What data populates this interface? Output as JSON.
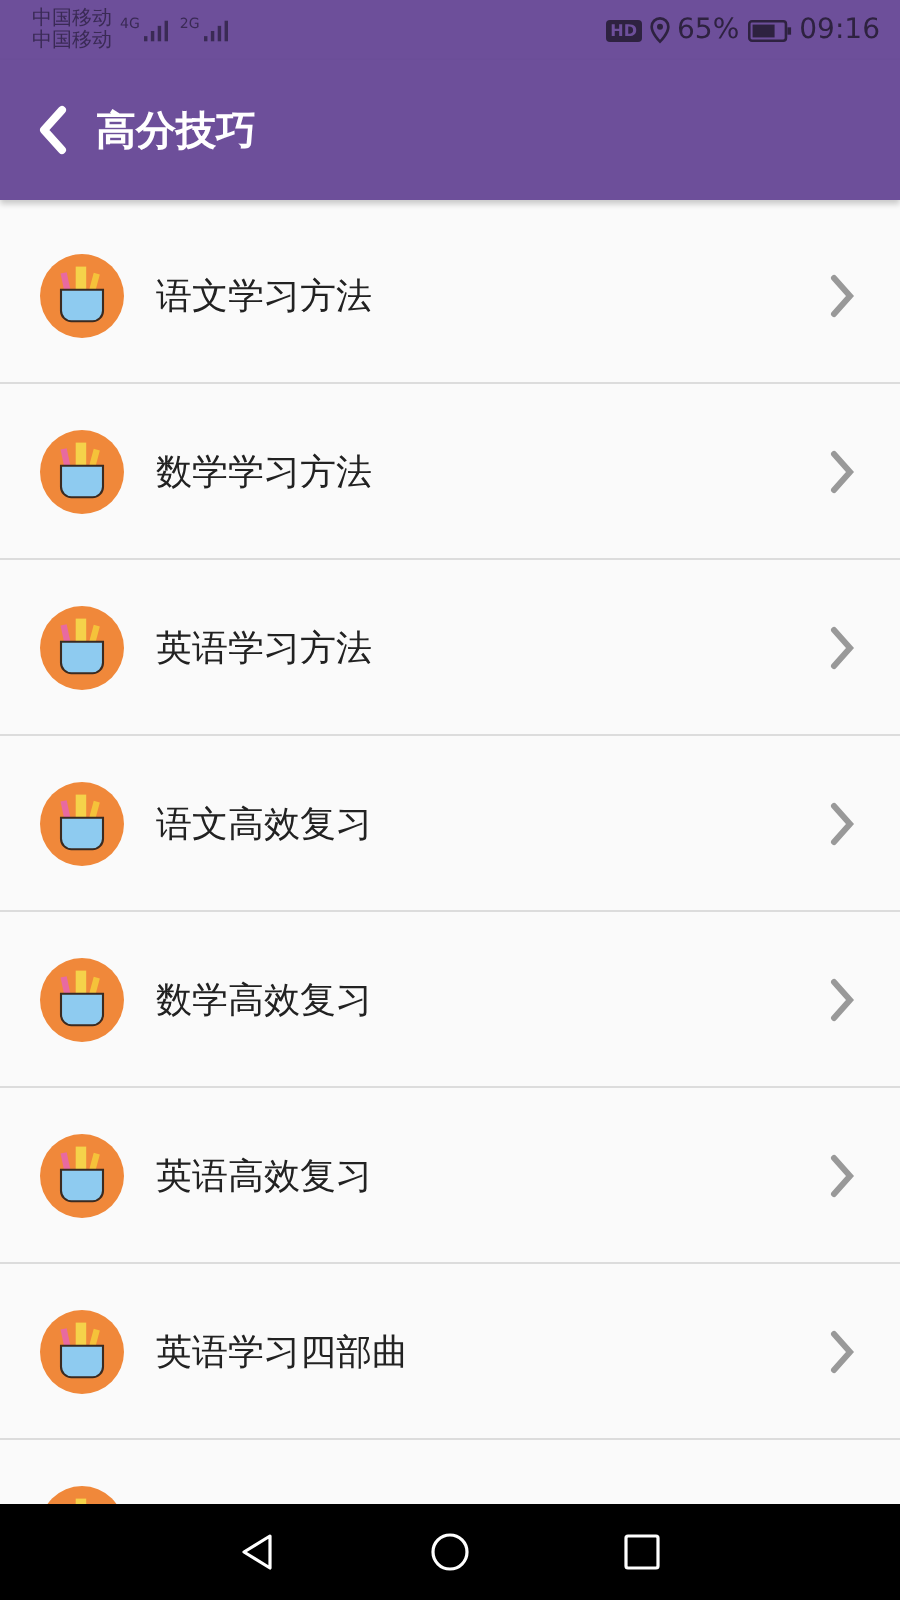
{
  "status_bar": {
    "carriers": [
      {
        "name": "中国移动",
        "network": "4G"
      },
      {
        "name": "中国移动",
        "network": "2G"
      }
    ],
    "hd": "HD",
    "battery": "65%",
    "time": "09:16"
  },
  "header": {
    "title": "高分技巧"
  },
  "items": [
    {
      "kind": "row",
      "title": "语文学习方法"
    },
    {
      "kind": "row",
      "title": "数学学习方法"
    },
    {
      "kind": "row",
      "title": "英语学习方法"
    },
    {
      "kind": "row",
      "title": "语文高效复习"
    },
    {
      "kind": "row",
      "title": "数学高效复习"
    },
    {
      "kind": "row",
      "title": "英语高效复习"
    },
    {
      "kind": "row",
      "title": "英语学习四部曲"
    },
    {
      "kind": "partial"
    }
  ]
}
